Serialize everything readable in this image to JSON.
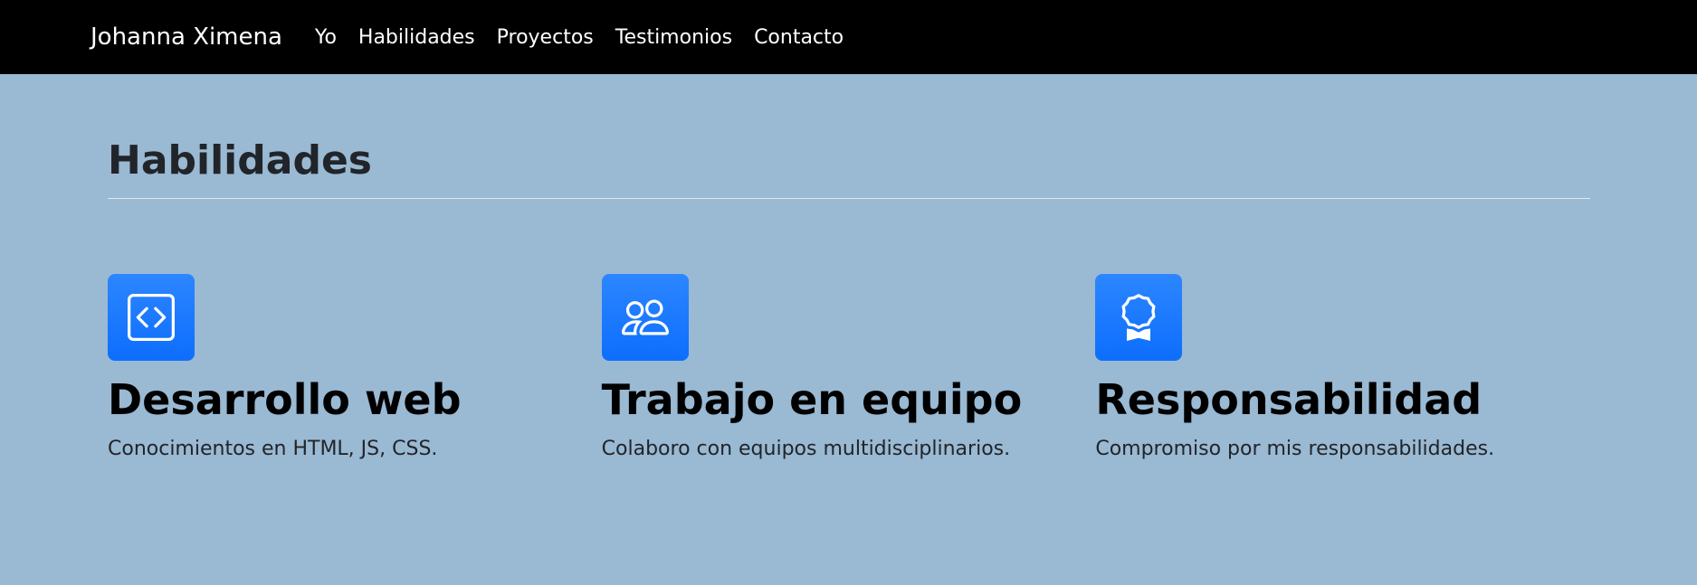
{
  "navbar": {
    "brand": "Johanna Ximena",
    "links": [
      "Yo",
      "Habilidades",
      "Proyectos",
      "Testimonios",
      "Contacto"
    ]
  },
  "skills": {
    "title": "Habilidades",
    "items": [
      {
        "icon": "code-square-icon",
        "title": "Desarrollo web",
        "text": "Conocimientos en HTML, JS, CSS."
      },
      {
        "icon": "people-icon",
        "title": "Trabajo en equipo",
        "text": "Colaboro con equipos multidisciplinarios."
      },
      {
        "icon": "award-icon",
        "title": "Responsabilidad",
        "text": "Compromiso por mis responsabilidades."
      }
    ]
  },
  "colors": {
    "background": "#9ab9d3",
    "navbar": "#000000",
    "icon_bg": "#0d6efd"
  }
}
